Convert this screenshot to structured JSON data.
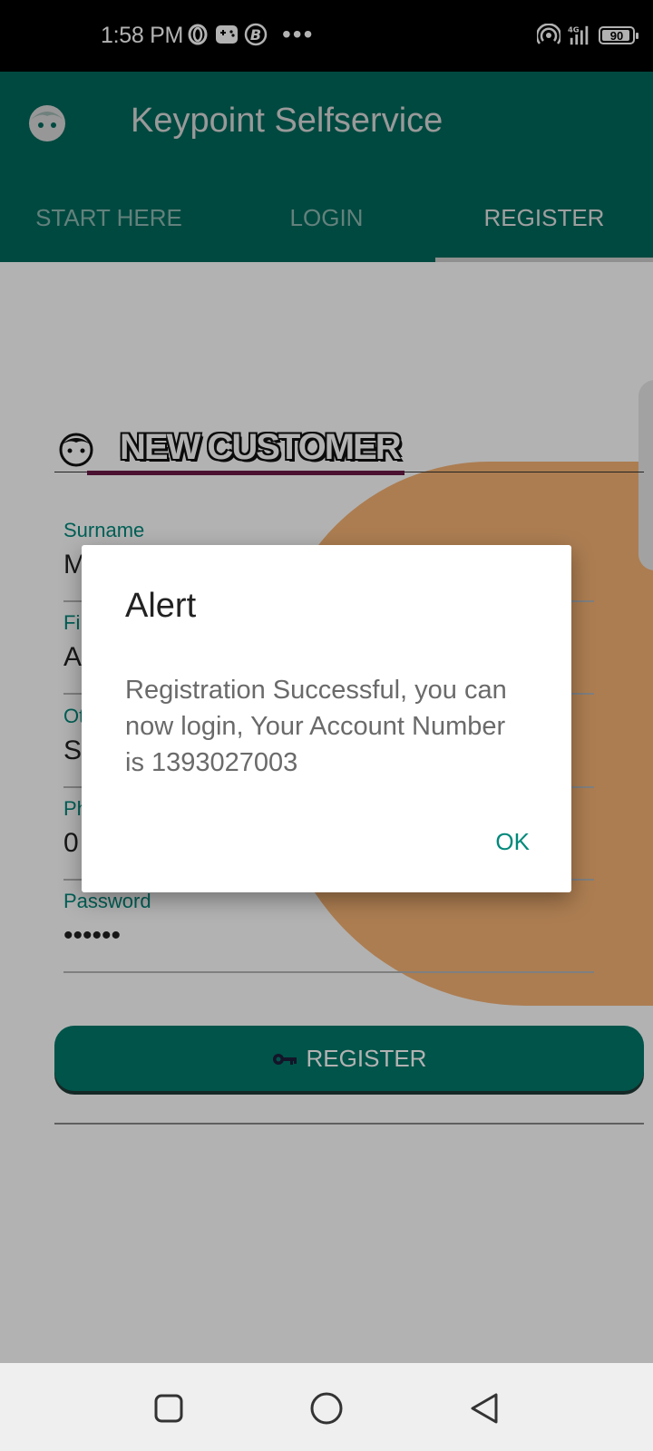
{
  "status_bar": {
    "time": "1:58 PM",
    "battery": "90",
    "left_icons": [
      "opera-icon",
      "gamepad-icon",
      "bixby-icon",
      "more-dots-icon"
    ],
    "right_icons": [
      "hotspot-icon",
      "signal-4g-icon",
      "battery-icon"
    ]
  },
  "app_bar": {
    "title": "Keypoint Selfservice",
    "tabs": [
      {
        "label": "START HERE"
      },
      {
        "label": "LOGIN"
      },
      {
        "label": "REGISTER"
      }
    ],
    "active_tab": "REGISTER",
    "color": "#00695c"
  },
  "form": {
    "section_title": "NEW CUSTOMER",
    "fields": [
      {
        "label": "Surname",
        "value": "M"
      },
      {
        "label": "Fi",
        "value": "A"
      },
      {
        "label": "Ot",
        "value": "S"
      },
      {
        "label": "Ph",
        "value": "0"
      },
      {
        "label": "Password",
        "value": "••••••"
      }
    ],
    "register_label": "REGISTER"
  },
  "dialog": {
    "title": "Alert",
    "message": "Registration Successful, you can now login, Your Account Number is 1393027003",
    "ok_label": "OK"
  },
  "colors": {
    "primary": "#00695c",
    "accent": "#00897b",
    "blob": "#f7b374"
  }
}
